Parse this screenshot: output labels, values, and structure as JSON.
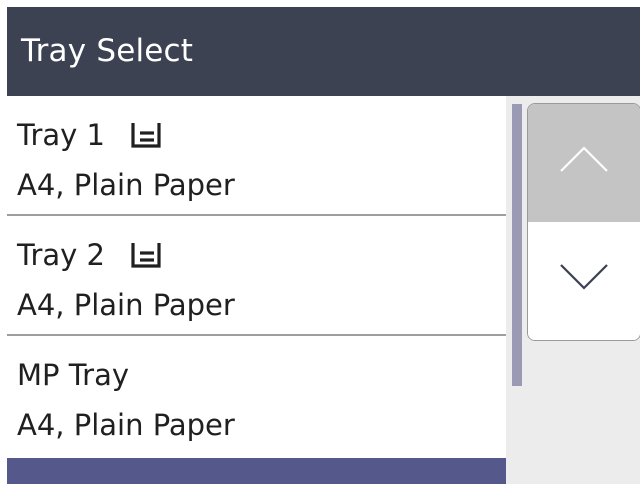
{
  "header": {
    "title": "Tray Select"
  },
  "trays": [
    {
      "name": "Tray 1",
      "setting": "A4, Plain Paper",
      "icon": "paper-tray-icon"
    },
    {
      "name": "Tray 2",
      "setting": "A4, Plain Paper",
      "icon": "paper-tray-icon"
    },
    {
      "name": "MP Tray",
      "setting": "A4, Plain Paper",
      "icon": ""
    }
  ],
  "scroll": {
    "up_icon": "chevron-up-icon",
    "down_icon": "chevron-down-icon"
  },
  "colors": {
    "header_bg": "#3d4252",
    "accent": "#54588a",
    "up_button_bg": "#c4c4c4",
    "scroll_bg": "#ececec"
  }
}
